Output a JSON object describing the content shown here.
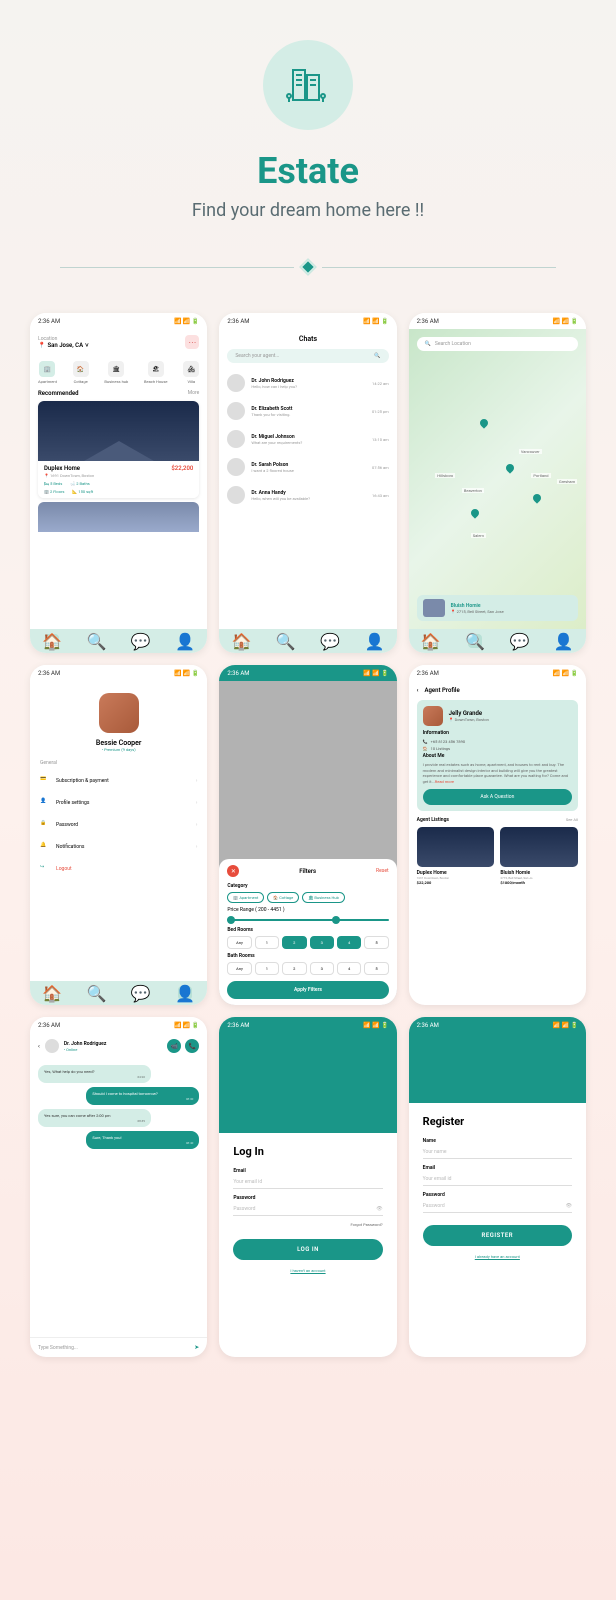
{
  "hero": {
    "title": "Estate",
    "subtitle": "Find your dream home here !!"
  },
  "status_time": "2:36 AM",
  "screens": {
    "home": {
      "location_label": "Location",
      "location_value": "San Jose, CA",
      "categories": [
        "Apartment",
        "Cottage",
        "Business hub",
        "Beach House",
        "Villa"
      ],
      "recommended_title": "Recommended",
      "recommended_more": "More",
      "card": {
        "title": "Duplex Home",
        "price": "$22,200",
        "address": "1691 DownTown, Boston",
        "beds": "5 Beds",
        "baths": "2 Baths",
        "floors": "2 Floors",
        "sqft": "150 sqft"
      }
    },
    "chats": {
      "title": "Chats",
      "search_placeholder": "Search your agent...",
      "items": [
        {
          "name": "Dr. John Rodriguez",
          "msg": "Hello, how can i help you?",
          "time": "14:22 am"
        },
        {
          "name": "Dr. Elizabeth Scott",
          "msg": "Thank you for visiting.",
          "time": "01:25 pm"
        },
        {
          "name": "Dr. Miguel Johnson",
          "msg": "What are your requirements?",
          "time": "13:10 am"
        },
        {
          "name": "Dr. Sarah Polson",
          "msg": "I want a 2 floored house",
          "time": "07:56 am"
        },
        {
          "name": "Dr. Anna Handy",
          "msg": "Hello, when will you be available?",
          "time": "16:43 am"
        }
      ]
    },
    "map": {
      "search_placeholder": "Search Location",
      "labels": [
        "Vancouver",
        "Portland",
        "Hillsboro",
        "Beaverton",
        "Gresham",
        "Salem"
      ],
      "card_title": "Bluish Homie",
      "card_address": "2715, Bell Street, San Jose"
    },
    "profile": {
      "name": "Bessie Cooper",
      "premium": "• Premium (9 days)",
      "section": "General",
      "items": [
        "Subscription & payment",
        "Profile settings",
        "Password",
        "Notifications",
        "Logout"
      ]
    },
    "filters": {
      "title": "Filters",
      "reset": "Reset",
      "category_label": "Category",
      "categories": [
        "Apartment",
        "Cottage",
        "Business Hub"
      ],
      "price_label": "Price Range ( 200 - 4451 )",
      "bedrooms_label": "Bed Rooms",
      "bathrooms_label": "Bath Rooms",
      "options": [
        "Any",
        "1",
        "2",
        "3",
        "4",
        "5"
      ],
      "apply": "Apply Filters"
    },
    "agent": {
      "header": "Agent Profile",
      "name": "Jelly Grande",
      "location": "DownTown, Boston",
      "info_label": "Information",
      "phone": "+65 8123 456 7890",
      "listings_count": "10 Listings",
      "about_label": "About Me",
      "about_text": "I provide real estates such as home, apartment, and houses to rent and buy. The modern and minimalist design interior and building will give you the greatest experience and comfortable place guarantee. What are you waiting for? Come and get it...",
      "read_more": "Read more",
      "ask_button": "Ask A Question",
      "listings_label": "Agent Listings",
      "see_all": "See All",
      "listings": [
        {
          "title": "Duplex Home",
          "addr": "1691 Downtown, Boston",
          "price": "$22,200"
        },
        {
          "title": "Bluish Homie",
          "addr": "2715, Bell Street, San Jo",
          "price": "$1800/month"
        }
      ]
    },
    "chat": {
      "name": "Dr. John Rodriguez",
      "status": "• Online",
      "messages": [
        {
          "text": "Yes, What help do you need?",
          "time": "04:20",
          "type": "in"
        },
        {
          "text": "Should I come to hospital tomorrow?",
          "time": "08:30",
          "type": "out"
        },
        {
          "text": "Yes sure, you can come after 2:00 pm",
          "time": "08:35",
          "type": "in"
        },
        {
          "text": "Sure, Thank you!",
          "time": "08:40",
          "type": "out"
        }
      ],
      "input_placeholder": "Type Something..."
    },
    "login": {
      "title": "Log In",
      "email_label": "Email",
      "email_placeholder": "Your email id",
      "password_label": "Password",
      "password_placeholder": "Password",
      "forgot": "Forgot Password?",
      "button": "LOG IN",
      "link": "I haven't an account"
    },
    "register": {
      "title": "Register",
      "name_label": "Name",
      "name_placeholder": "Your name",
      "email_label": "Email",
      "email_placeholder": "Your email id",
      "password_label": "Password",
      "password_placeholder": "Password",
      "button": "REGISTER",
      "link": "I already have an account"
    }
  }
}
